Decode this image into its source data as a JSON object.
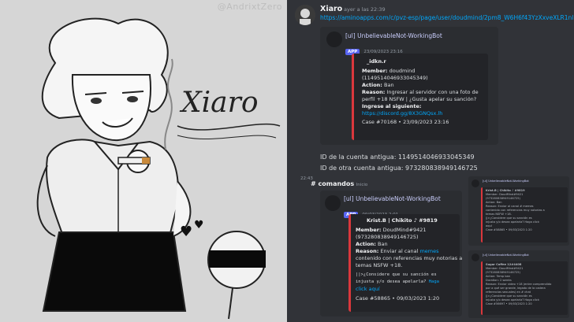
{
  "art": {
    "watermark": "@AndrixtZero",
    "signature": "Xiaro"
  },
  "message": {
    "username": "Xiaro",
    "timestamp": "ayer a las 22:39",
    "link": "https://aminoapps.com/c/pvz-esp/page/user/doudmind/2pm8_W6H6f43YzXxveXLR1nlLq7eWVWlp0"
  },
  "embed1": {
    "bot_name": "[ul] UnbelievableNot-WorkingBot",
    "app_tag": "APP",
    "date": "23/09/2023 23:16",
    "card_title": "_idkn.r",
    "member_label": "Member:",
    "member_value": "doudmind",
    "member_id": "(1149514046933045349)",
    "action_label": "Action:",
    "action_value": "Ban",
    "reason_label": "Reason:",
    "reason_value": "Ingresar al servidor con una foto de",
    "reason_value2": "perfil +18 NSFW | ¿Gusta apelar su sanción?",
    "ingrese_label": "Ingrese al siguiente:",
    "invite": "https://discord.gg/8X3GNQsx.lh",
    "case": "Case #70168 • 23/09/2023 23:16"
  },
  "ids": {
    "old": "ID de la cuenta antigua: 1149514046933045349",
    "other": "ID de otra cuenta antigua: 973280838949146725"
  },
  "second": {
    "time": "22:43",
    "channel": "# comandos",
    "channel_tag": "Inicio",
    "bot_name": "[ul] UnbelievableNot-WorkingBot",
    "app_tag": "APP",
    "date": "09/03/2023 2:01",
    "card_title": "Krist.B | Chikito ♪ #9819",
    "member_label": "Member:",
    "member_value": "DoudMind#9421",
    "member_id": "(973280838949146725)",
    "action_label": "Action:",
    "action_value": "Ban",
    "reason_label": "Reason:",
    "reason_value": "Enviar al canal",
    "reason_value_chan": "memes",
    "reason_value2": "contenido con referencias muy notorias a",
    "reason_value3": "temas NSFW +18.",
    "appeal": "||>¿Considere que su sanción es",
    "appeal2": "injusta y/o desea apelarla?",
    "appeal_link": "Haga",
    "appeal_link2": "click aquí",
    "case": "Case #58865 • 09/03/2023 1:20"
  },
  "mini1": {
    "bot_name": "[ul] UnbelievableNot-WorkingBot",
    "title": "Krist.B | Chikito ♪ #9819",
    "lines": [
      "Member: DoudMind#9421",
      "(973280838949146725)",
      "Action: Ban",
      "Reason: Enviar al canal # memes",
      "contenido con referencias muy notorias a",
      "temas NSFW +18.",
      "",
      "||>¿Considere que su sanción es",
      "injusta y/o desea apelarla? Haga click",
      "aquí",
      "Case #58865 • 09/03/2023 1:20"
    ]
  },
  "mini2": {
    "bot_name": "[ul] UnbelievableNot-WorkingBot",
    "title": "Sugar Coffee 12#4408",
    "lines": [
      "Member: DoudMind#9421",
      "(973280838949146725)",
      "Action: Temp ban",
      "Duration: 2 weeks",
      "Reason: Enviar video +18 (entre comprendido",
      "por a qué ser grande, legado de la cadera",
      "referencias sexuales) en # chat",
      "||>¿Considere que su sanción es",
      "injusta y/o desea apelarla? Haga click",
      "Case #56697 • 09/03/2023 1:20"
    ]
  }
}
